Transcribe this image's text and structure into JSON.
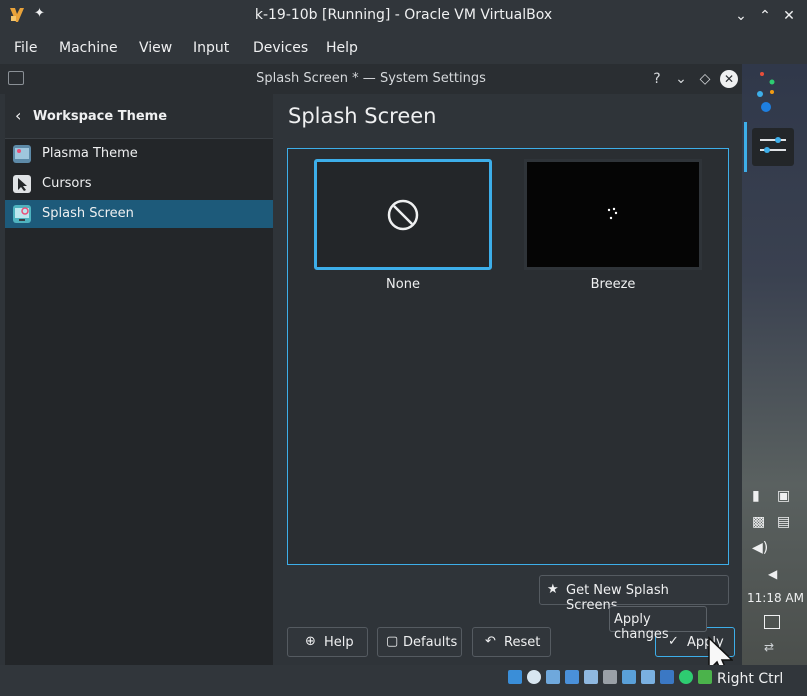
{
  "vbox": {
    "title": "k-19-10b [Running] - Oracle VM VirtualBox",
    "menu": [
      "File",
      "Machine",
      "View",
      "Input",
      "Devices",
      "Help"
    ],
    "host_key": "Right Ctrl"
  },
  "settings_window": {
    "title": "Splash Screen * — System Settings",
    "sidebar": {
      "back_label": "Workspace Theme",
      "items": [
        {
          "label": "Plasma Theme",
          "icon": "plasma-theme-icon",
          "active": false
        },
        {
          "label": "Cursors",
          "icon": "cursor-icon",
          "active": false
        },
        {
          "label": "Splash Screen",
          "icon": "splash-screen-icon",
          "active": true
        }
      ]
    },
    "page_title": "Splash Screen",
    "themes": [
      {
        "label": "None",
        "selected": true
      },
      {
        "label": "Breeze",
        "selected": false
      }
    ],
    "get_new_label": "Get New Splash Screens...",
    "buttons": {
      "help": "Help",
      "defaults": "Defaults",
      "reset": "Reset",
      "apply": "Apply"
    },
    "tooltip": "Apply changes"
  },
  "panel": {
    "clock": "11:18 AM"
  },
  "colors": {
    "accent": "#3daee9",
    "selection": "#1d5a7a",
    "background": "#2f3439"
  }
}
